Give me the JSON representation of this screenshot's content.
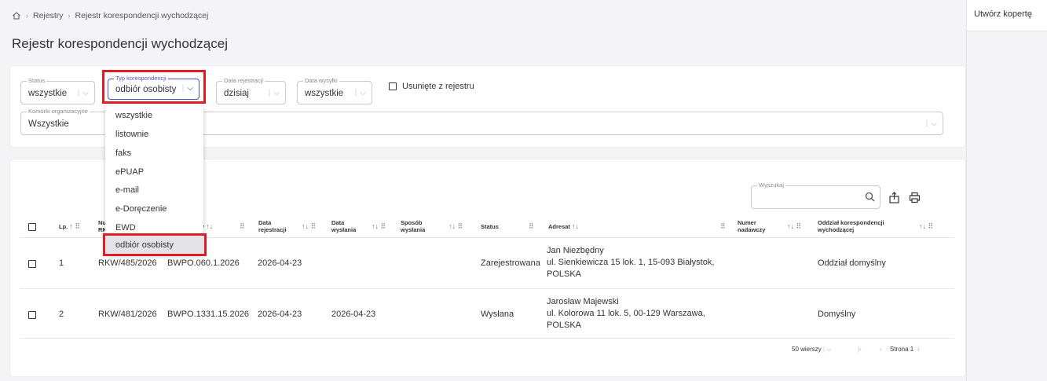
{
  "breadcrumb": {
    "level1": "Rejestry",
    "level2": "Rejestr korespondencji wychodzącej"
  },
  "page_title": "Rejestr korespondencji wychodzącej",
  "right_panel": {
    "button": "Utwórz kopertę"
  },
  "filters": {
    "status": {
      "label": "Status",
      "value": "wszystkie"
    },
    "typ": {
      "label": "Typ korespondencji",
      "value": "odbiór osobisty"
    },
    "data_rejestracji": {
      "label": "Data rejestracji",
      "value": "dzisiaj"
    },
    "data_wysylki": {
      "label": "Data wysyłki",
      "value": "wszystkie"
    },
    "usuniete": "Usunięte z rejestru",
    "komorki": {
      "label": "Komórki organizacyjne",
      "value": "Wszystkie"
    }
  },
  "dropdown": {
    "options": [
      "wszystkie",
      "listownie",
      "faks",
      "ePUAP",
      "e-mail",
      "e-Doręczenie",
      "EWD",
      "odbiór osobisty"
    ],
    "selected": "odbiór osobisty"
  },
  "search": {
    "label": "Wyszukaj"
  },
  "table": {
    "headers": {
      "lp": "Lp.",
      "numer": "Nu",
      "numer2": "RK",
      "znak": "y",
      "data_rej1": "Data",
      "data_rej2": "rejestracji",
      "data_wys1": "Data",
      "data_wys2": "wysłania",
      "sposob1": "Sposób",
      "sposob2": "wysłania",
      "status": "Status",
      "adresat": "Adresat",
      "numer_nad1": "Numer",
      "numer_nad2": "nadawczy",
      "oddzial1": "Oddział korespondencji",
      "oddzial2": "wychodzącej"
    },
    "rows": [
      {
        "lp": "1",
        "numer": "RKW/485/2026",
        "znak": "BWPO.060.1.2026",
        "data_rej": "2026-04-23",
        "data_wys": "",
        "status": "Zarejestrowana",
        "adresat1": "Jan Niezbędny",
        "adresat2": "ul. Sienkiewicza 15 lok. 1, 15-093 Białystok,",
        "adresat3": "POLSKA",
        "oddzial": "Oddział domyślny"
      },
      {
        "lp": "2",
        "numer": "RKW/481/2026",
        "znak": "BWPO.1331.15.2026",
        "data_rej": "2026-04-23",
        "data_wys": "2026-04-23",
        "status": "Wysłana",
        "adresat1": "Jarosław Majewski",
        "adresat2": "ul. Kolorowa 11 lok. 5, 00-129 Warszawa,",
        "adresat3": "POLSKA",
        "oddzial": "Domyślny"
      }
    ]
  },
  "pager": {
    "rows": "50 wierszy",
    "page": "Strona 1"
  },
  "colors": {
    "highlight": "#e01c24",
    "accent": "#4a55c9"
  }
}
